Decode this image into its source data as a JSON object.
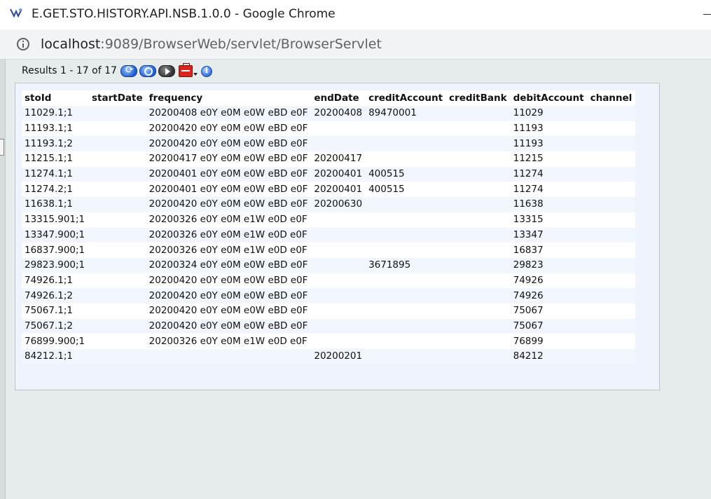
{
  "window": {
    "title": "E.GET.STO.HISTORY.API.NSB.1.0.0 - Google Chrome"
  },
  "address_bar": {
    "host": "localhost",
    "path": ":9089/BrowserWeb/servlet/BrowserServlet"
  },
  "toolbar": {
    "results_text": "Results 1 - 17 of 17",
    "icons": [
      "refresh-icon",
      "search-icon",
      "next-icon",
      "tools-icon",
      "info-icon"
    ]
  },
  "table": {
    "columns": [
      "stoId",
      "startDate",
      "frequency",
      "endDate",
      "creditAccount",
      "creditBank",
      "debitAccount",
      "channel"
    ],
    "rows": [
      [
        "11029.1;1",
        "",
        "20200408 e0Y e0M e0W eBD e0F",
        "20200408",
        "89470001",
        "",
        "11029",
        ""
      ],
      [
        "11193.1;1",
        "",
        "20200420 e0Y e0M e0W eBD e0F",
        "",
        "",
        "",
        "11193",
        ""
      ],
      [
        "11193.1;2",
        "",
        "20200420 e0Y e0M e0W eBD e0F",
        "",
        "",
        "",
        "11193",
        ""
      ],
      [
        "11215.1;1",
        "",
        "20200417 e0Y e0M e0W eBD e0F",
        "20200417",
        "",
        "",
        "11215",
        ""
      ],
      [
        "11274.1;1",
        "",
        "20200401 e0Y e0M e0W eBD e0F",
        "20200401",
        "400515",
        "",
        "11274",
        ""
      ],
      [
        "11274.2;1",
        "",
        "20200401 e0Y e0M e0W eBD e0F",
        "20200401",
        "400515",
        "",
        "11274",
        ""
      ],
      [
        "11638.1;1",
        "",
        "20200420 e0Y e0M e0W eBD e0F",
        "20200630",
        "",
        "",
        "11638",
        ""
      ],
      [
        "13315.901;1",
        "",
        "20200326 e0Y e0M e1W e0D e0F",
        "",
        "",
        "",
        "13315",
        ""
      ],
      [
        "13347.900;1",
        "",
        "20200326 e0Y e0M e1W e0D e0F",
        "",
        "",
        "",
        "13347",
        ""
      ],
      [
        "16837.900;1",
        "",
        "20200326 e0Y e0M e1W e0D e0F",
        "",
        "",
        "",
        "16837",
        ""
      ],
      [
        "29823.900;1",
        "",
        "20200324 e0Y e0M e0W eBD e0F",
        "",
        "3671895",
        "",
        "29823",
        ""
      ],
      [
        "74926.1;1",
        "",
        "20200420 e0Y e0M e0W eBD e0F",
        "",
        "",
        "",
        "74926",
        ""
      ],
      [
        "74926.1;2",
        "",
        "20200420 e0Y e0M e0W eBD e0F",
        "",
        "",
        "",
        "74926",
        ""
      ],
      [
        "75067.1;1",
        "",
        "20200420 e0Y e0M e0W eBD e0F",
        "",
        "",
        "",
        "75067",
        ""
      ],
      [
        "75067.1;2",
        "",
        "20200420 e0Y e0M e0W eBD e0F",
        "",
        "",
        "",
        "75067",
        ""
      ],
      [
        "76899.900;1",
        "",
        "20200326 e0Y e0M e1W e0D e0F",
        "",
        "",
        "",
        "76899",
        ""
      ],
      [
        "84212.1;1",
        "",
        "",
        "20200201",
        "",
        "",
        "84212",
        ""
      ]
    ]
  }
}
